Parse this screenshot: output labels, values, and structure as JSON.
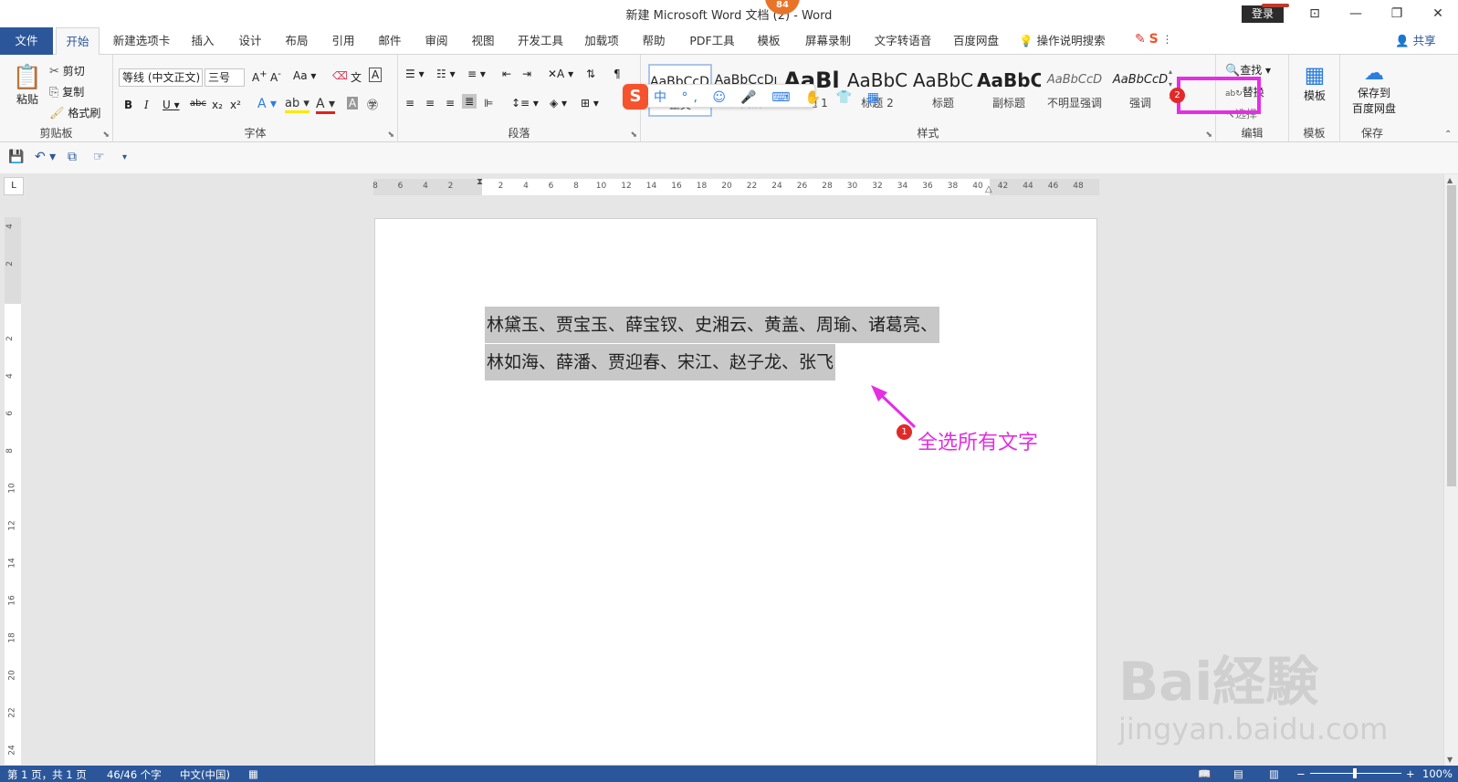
{
  "window": {
    "title": "新建 Microsoft Word 文档 (2) - Word",
    "notification_count": "84",
    "login_label": "登录",
    "controls": [
      "⊡",
      "—",
      "❐",
      "✕"
    ]
  },
  "tabs": {
    "file": "文件",
    "items": [
      "开始",
      "新建选项卡",
      "插入",
      "设计",
      "布局",
      "引用",
      "邮件",
      "审阅",
      "视图",
      "开发工具",
      "加载项",
      "帮助",
      "PDF工具",
      "模板",
      "屏幕录制",
      "文字转语音",
      "百度网盘"
    ],
    "active": "开始",
    "tell_me": "操作说明搜索",
    "share": "共享"
  },
  "ribbon": {
    "clipboard": {
      "label": "剪贴板",
      "paste": "粘贴",
      "cut": "剪切",
      "copy": "复制",
      "format_painter": "格式刷"
    },
    "font": {
      "label": "字体",
      "font_name": "等线 (中文正文)",
      "font_size": "三号"
    },
    "paragraph": {
      "label": "段落"
    },
    "styles": {
      "label": "样式",
      "items": [
        {
          "preview": "AaBbCcDı",
          "name": "正文"
        },
        {
          "preview": "AaBbCcDı",
          "name": "无间隔"
        },
        {
          "preview": "AaBl",
          "name": "标题 1"
        },
        {
          "preview": "AaBbC",
          "name": "标题 2"
        },
        {
          "preview": "AaBbC",
          "name": "标题"
        },
        {
          "preview": "AaBbC",
          "name": "副标题"
        },
        {
          "preview": "AaBbCcD",
          "name": "不明显强调"
        },
        {
          "preview": "AaBbCcD",
          "name": "强调"
        }
      ]
    },
    "editing": {
      "label": "编辑",
      "find": "查找",
      "replace": "替换",
      "select": "选择"
    },
    "template": {
      "label": "模板",
      "button": "模板"
    },
    "save": {
      "label": "保存",
      "button_line1": "保存到",
      "button_line2": "百度网盘"
    }
  },
  "ime": {
    "logo": "S",
    "items": "中 °, ☺ 🎤 ⌨ ✋ 👕 ▦"
  },
  "ruler": {
    "h_ticks": [
      "8",
      "6",
      "4",
      "2",
      "",
      "2",
      "4",
      "6",
      "8",
      "10",
      "12",
      "14",
      "16",
      "18",
      "20",
      "22",
      "24",
      "26",
      "28",
      "30",
      "32",
      "34",
      "36",
      "38",
      "40",
      "42",
      "44",
      "46",
      "48"
    ],
    "v_ticks": [
      "4",
      "2",
      "",
      "2",
      "4",
      "6",
      "8",
      "10",
      "12",
      "14",
      "16",
      "18",
      "20",
      "22",
      "24"
    ]
  },
  "document": {
    "line1": "林黛玉、贾宝玉、薛宝钗、史湘云、黄盖、周瑜、诸葛亮、",
    "line2": "林如海、薛潘、贾迎春、宋江、赵子龙、张飞"
  },
  "annotations": {
    "step1_badge": "1",
    "step1_text": "全选所有文字",
    "step2_badge": "2",
    "highlight_color": "#e62de6"
  },
  "status_bar": {
    "page": "第 1 页，共 1 页",
    "words": "46/46 个字",
    "language": "中文(中国)",
    "zoom": "100%"
  },
  "watermark": {
    "line1": "Bai経験",
    "line2": "jingyan.baidu.com"
  },
  "colors": {
    "accent": "#2b579a",
    "selection": "#c8c8c8"
  }
}
